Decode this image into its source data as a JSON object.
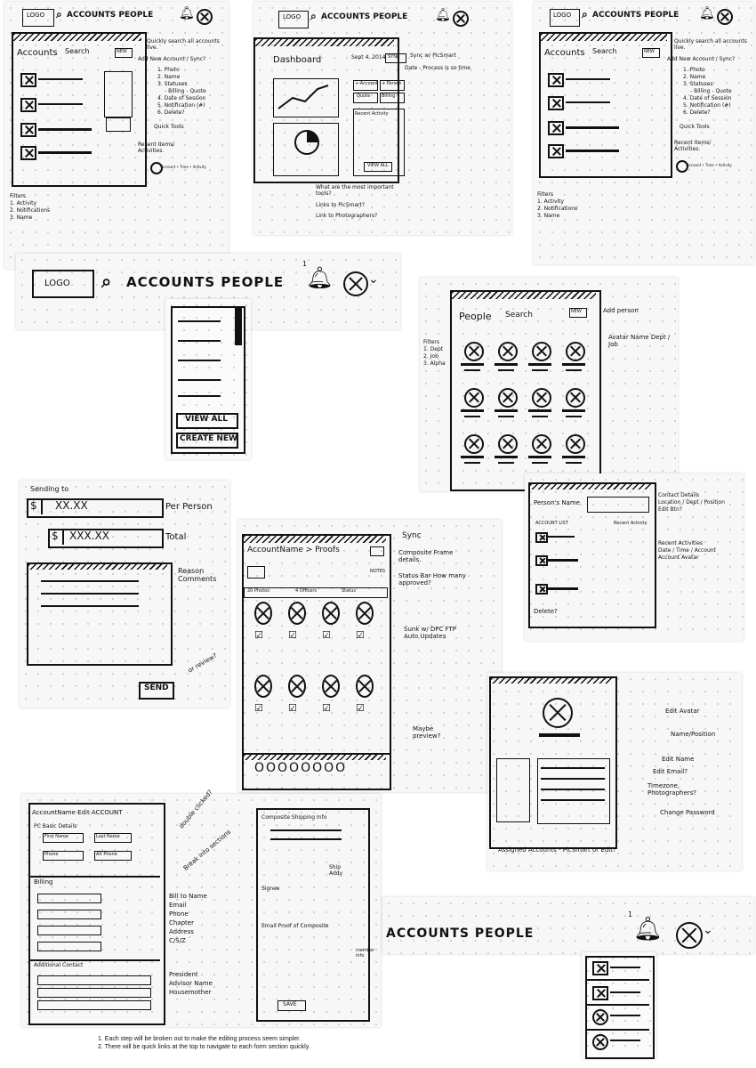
{
  "header": {
    "logo": "LOGO",
    "nav": "ACCOUNTS PEOPLE",
    "search_icon": "search-icon",
    "bell_icon": "bell-icon",
    "avatar_icon": "avatar-icon",
    "badge": "1"
  },
  "accounts": {
    "title": "Accounts",
    "search": "Search",
    "new": "NEW",
    "notes": [
      "Quickly search all accounts live.",
      "Add New Account / Sync?"
    ],
    "fields": [
      "1. Photo",
      "2. Name",
      "3. Statuses",
      "- Billing - Quote",
      "4. Date of Session",
      "5. Notification (#)",
      "6. Delete?"
    ],
    "quick_tools": "Quick Tools",
    "recent": "Recent Items/ Activities.",
    "recent_meta": "Account • Time • Activity",
    "filters": [
      "Filters",
      "1. Activity",
      "2. Notifications",
      "3. Name"
    ]
  },
  "dashboard": {
    "title": "Dashboard",
    "date": "Sept 4, 2014",
    "sync": "SYNC",
    "notes": [
      "Sync w/ PicSmart",
      "Date - Process is so time"
    ],
    "buttons": [
      "+ Account",
      "+ Person",
      "Quote",
      "Billing"
    ],
    "recent_title": "Recent Activity",
    "view_all": "VIEW ALL",
    "questions": [
      "What are the most important tools?",
      "Links to PicSmart?",
      "Link to Photographers?"
    ]
  },
  "dropdown": {
    "view_all": "VIEW ALL",
    "create_new": "CREATE NEW"
  },
  "people": {
    "title": "People",
    "search": "Search",
    "new": "NEW",
    "add_person": "Add person",
    "filters": [
      "Filters",
      "1. Dept",
      "2. Job",
      "3. Alpha"
    ],
    "avatar_note": "Avatar Name Dept / Job"
  },
  "sending": {
    "title": "Sending to",
    "per_value": "XX.XX",
    "per_label": "Per Person",
    "total_value": "XXX.XX",
    "total_label": "Total",
    "reason": "Reason Comments",
    "review": "or review?",
    "send": "SEND"
  },
  "proofs": {
    "title": "AccountName > Proofs",
    "sync": "Sync",
    "notes": [
      "Composite Frame details.",
      "Status Bar How many approved?",
      "Sunk w/ DPC FTP Auto Updates",
      "Maybe preview?"
    ],
    "tabs": [
      "20 Photos",
      "4 Officers",
      "Status"
    ],
    "notes_label": "NOTES"
  },
  "person_detail": {
    "title": "Person's Name",
    "account_list": "ACCOUNT LIST",
    "recent": "Recent Activity",
    "delete": "Delete?",
    "notes": [
      "Contact Details",
      "Location / Dept / Position",
      "Edit Btn?",
      "Recent Activities",
      "Date / Time / Account",
      "Account Avatar"
    ]
  },
  "edit_profile": {
    "notes": [
      "Edit Avatar",
      "Name/Position",
      "Edit Name",
      "Edit Email?",
      "Timezone, Photographers?",
      "Change Password",
      "Assigned Accounts - PicSmart or Edit?"
    ]
  },
  "edit_account": {
    "title": "AccountName Edit ACCOUNT",
    "basic": "PC Basic Details",
    "fields": [
      "First Name",
      "Last Name",
      "Phone",
      "Alt Phone"
    ],
    "billing": "Billing",
    "billing_notes": [
      "Bill to Name",
      "Email",
      "Phone",
      "Chapter",
      "Address",
      "C/S/Z"
    ],
    "additional": "Additional Contact",
    "contact_notes": [
      "President",
      "Advisor Name",
      "Housemother"
    ],
    "double_click": "double clicked?",
    "break_into": "Break into sections",
    "shipping": "Composite Shipping Info",
    "ship_note": "Ship Addy",
    "signee": "Signee",
    "email_proof": "Email Proof of Composite",
    "member_info": "member info",
    "save": "SAVE"
  },
  "notification": {
    "nav": "ACCOUNTS PEOPLE",
    "badge": "1"
  },
  "footnotes": [
    "1. Each step will be broken out to make the editing process seem simpler.",
    "2. There will be quick links at the top to navigate to each form section quickly."
  ]
}
